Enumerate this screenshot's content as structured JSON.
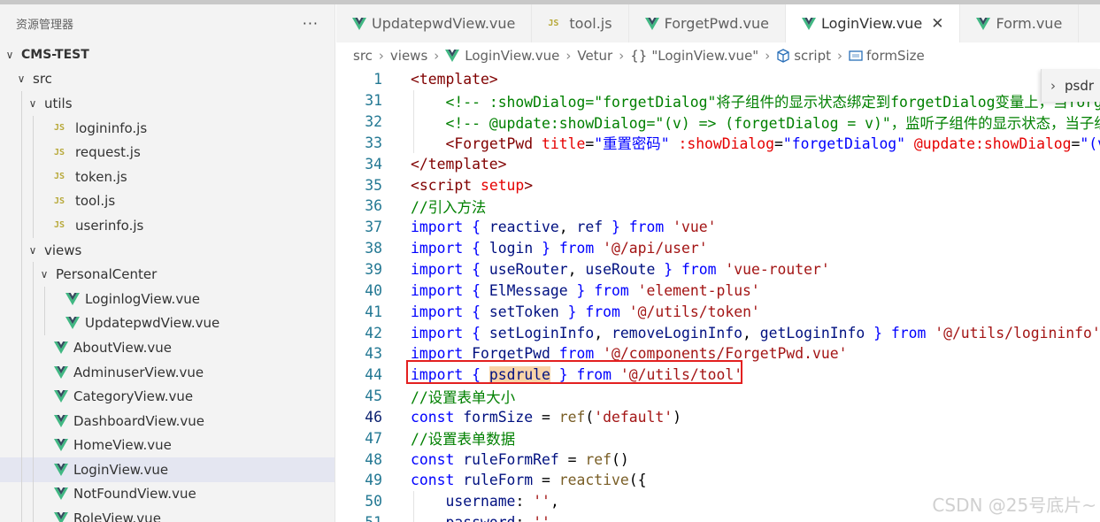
{
  "explorer": {
    "title": "资源管理器",
    "more": "···",
    "root": "CMS-TEST",
    "items": [
      {
        "label": "src",
        "type": "folder",
        "depth": 1,
        "open": true
      },
      {
        "label": "utils",
        "type": "folder",
        "depth": 2,
        "open": true
      },
      {
        "label": "logininfo.js",
        "type": "js",
        "depth": 3
      },
      {
        "label": "request.js",
        "type": "js",
        "depth": 3
      },
      {
        "label": "token.js",
        "type": "js",
        "depth": 3
      },
      {
        "label": "tool.js",
        "type": "js",
        "depth": 3
      },
      {
        "label": "userinfo.js",
        "type": "js",
        "depth": 3
      },
      {
        "label": "views",
        "type": "folder",
        "depth": 2,
        "open": true
      },
      {
        "label": "PersonalCenter",
        "type": "folder",
        "depth": 3,
        "open": true
      },
      {
        "label": "LoginlogView.vue",
        "type": "vue",
        "depth": 4
      },
      {
        "label": "UpdatepwdView.vue",
        "type": "vue",
        "depth": 4
      },
      {
        "label": "AboutView.vue",
        "type": "vue",
        "depth": 3
      },
      {
        "label": "AdminuserView.vue",
        "type": "vue",
        "depth": 3
      },
      {
        "label": "CategoryView.vue",
        "type": "vue",
        "depth": 3
      },
      {
        "label": "DashboardView.vue",
        "type": "vue",
        "depth": 3
      },
      {
        "label": "HomeView.vue",
        "type": "vue",
        "depth": 3
      },
      {
        "label": "LoginView.vue",
        "type": "vue",
        "depth": 3,
        "selected": true
      },
      {
        "label": "NotFoundView.vue",
        "type": "vue",
        "depth": 3
      },
      {
        "label": "RoleView.vue",
        "type": "vue",
        "depth": 3
      }
    ]
  },
  "tabs": [
    {
      "label": "UpdatepwdView.vue",
      "type": "vue"
    },
    {
      "label": "tool.js",
      "type": "js"
    },
    {
      "label": "ForgetPwd.vue",
      "type": "vue"
    },
    {
      "label": "LoginView.vue",
      "type": "vue",
      "active": true,
      "close": "✕"
    },
    {
      "label": "Form.vue",
      "type": "vue"
    }
  ],
  "breadcrumb": {
    "parts": [
      "src",
      "views",
      "LoginView.vue",
      "Vetur",
      "\"LoginView.vue\"",
      "script",
      "formSize"
    ],
    "sep": "›"
  },
  "sticky_suggest": {
    "arrow": "›",
    "label": "psdr"
  },
  "code": [
    {
      "n": "1",
      "tokens": [
        [
          "t-tag",
          "<template>"
        ]
      ]
    },
    {
      "n": "31",
      "tokens": [
        [
          "t-plain",
          "    "
        ],
        [
          "t-cm",
          "<!-- :showDialog=\"forgetDialog\"将子组件的显示状态绑定到forgetDialog变量上，当forgetDialog为true时显示子组件 -->"
        ]
      ]
    },
    {
      "n": "32",
      "tokens": [
        [
          "t-plain",
          "    "
        ],
        [
          "t-cm",
          "<!-- @update:showDialog=\"(v) => (forgetDialog = v)\"，监听子组件的显示状态，当子组件关闭时更新forgetDialog -->"
        ]
      ]
    },
    {
      "n": "33",
      "tokens": [
        [
          "t-plain",
          "    "
        ],
        [
          "t-tag",
          "<ForgetPwd"
        ],
        [
          "t-plain",
          " "
        ],
        [
          "t-attr",
          "title"
        ],
        [
          "t-plain",
          "="
        ],
        [
          "t-str",
          "\"重置密码\""
        ],
        [
          "t-plain",
          " "
        ],
        [
          "t-attr",
          ":showDialog"
        ],
        [
          "t-plain",
          "="
        ],
        [
          "t-str",
          "\"forgetDialog\""
        ],
        [
          "t-plain",
          " "
        ],
        [
          "t-attr",
          "@update:showDialog"
        ],
        [
          "t-plain",
          "="
        ],
        [
          "t-str",
          "\"(v) => (forgetDialog = v)\""
        ],
        [
          "t-tag",
          "/>"
        ]
      ]
    },
    {
      "n": "34",
      "tokens": [
        [
          "t-tag",
          "</template>"
        ]
      ]
    },
    {
      "n": "35",
      "tokens": [
        [
          "t-tag",
          "<script"
        ],
        [
          "t-plain",
          " "
        ],
        [
          "t-attr",
          "setup"
        ],
        [
          "t-tag",
          ">"
        ]
      ]
    },
    {
      "n": "36",
      "tokens": [
        [
          "t-cm",
          "//引入方法"
        ]
      ]
    },
    {
      "n": "37",
      "tokens": [
        [
          "t-kw",
          "import"
        ],
        [
          "t-plain",
          " "
        ],
        [
          "t-kw",
          "{"
        ],
        [
          "t-plain",
          " "
        ],
        [
          "t-var",
          "reactive"
        ],
        [
          "t-plain",
          ", "
        ],
        [
          "t-var",
          "ref"
        ],
        [
          "t-plain",
          " "
        ],
        [
          "t-kw",
          "}"
        ],
        [
          "t-plain",
          " "
        ],
        [
          "t-kw",
          "from"
        ],
        [
          "t-plain",
          " "
        ],
        [
          "t-str2",
          "'vue'"
        ]
      ]
    },
    {
      "n": "38",
      "tokens": [
        [
          "t-kw",
          "import"
        ],
        [
          "t-plain",
          " "
        ],
        [
          "t-kw",
          "{"
        ],
        [
          "t-plain",
          " "
        ],
        [
          "t-var",
          "login"
        ],
        [
          "t-plain",
          " "
        ],
        [
          "t-kw",
          "}"
        ],
        [
          "t-plain",
          " "
        ],
        [
          "t-kw",
          "from"
        ],
        [
          "t-plain",
          " "
        ],
        [
          "t-str2",
          "'@/api/user'"
        ]
      ]
    },
    {
      "n": "39",
      "tokens": [
        [
          "t-kw",
          "import"
        ],
        [
          "t-plain",
          " "
        ],
        [
          "t-kw",
          "{"
        ],
        [
          "t-plain",
          " "
        ],
        [
          "t-var",
          "useRouter"
        ],
        [
          "t-plain",
          ", "
        ],
        [
          "t-var",
          "useRoute"
        ],
        [
          "t-plain",
          " "
        ],
        [
          "t-kw",
          "}"
        ],
        [
          "t-plain",
          " "
        ],
        [
          "t-kw",
          "from"
        ],
        [
          "t-plain",
          " "
        ],
        [
          "t-str2",
          "'vue-router'"
        ]
      ]
    },
    {
      "n": "40",
      "tokens": [
        [
          "t-kw",
          "import"
        ],
        [
          "t-plain",
          " "
        ],
        [
          "t-kw",
          "{"
        ],
        [
          "t-plain",
          " "
        ],
        [
          "t-var",
          "ElMessage"
        ],
        [
          "t-plain",
          " "
        ],
        [
          "t-kw",
          "}"
        ],
        [
          "t-plain",
          " "
        ],
        [
          "t-kw",
          "from"
        ],
        [
          "t-plain",
          " "
        ],
        [
          "t-str2",
          "'element-plus'"
        ]
      ]
    },
    {
      "n": "41",
      "tokens": [
        [
          "t-kw",
          "import"
        ],
        [
          "t-plain",
          " "
        ],
        [
          "t-kw",
          "{"
        ],
        [
          "t-plain",
          " "
        ],
        [
          "t-var",
          "setToken"
        ],
        [
          "t-plain",
          " "
        ],
        [
          "t-kw",
          "}"
        ],
        [
          "t-plain",
          " "
        ],
        [
          "t-kw",
          "from"
        ],
        [
          "t-plain",
          " "
        ],
        [
          "t-str2",
          "'@/utils/token'"
        ]
      ]
    },
    {
      "n": "42",
      "tokens": [
        [
          "t-kw",
          "import"
        ],
        [
          "t-plain",
          " "
        ],
        [
          "t-kw",
          "{"
        ],
        [
          "t-plain",
          " "
        ],
        [
          "t-var",
          "setLoginInfo"
        ],
        [
          "t-plain",
          ", "
        ],
        [
          "t-var",
          "removeLoginInfo"
        ],
        [
          "t-plain",
          ", "
        ],
        [
          "t-var",
          "getLoginInfo"
        ],
        [
          "t-plain",
          " "
        ],
        [
          "t-kw",
          "}"
        ],
        [
          "t-plain",
          " "
        ],
        [
          "t-kw",
          "from"
        ],
        [
          "t-plain",
          " "
        ],
        [
          "t-str2",
          "'@/utils/logininfo'"
        ]
      ]
    },
    {
      "n": "43",
      "tokens": [
        [
          "t-kw",
          "import"
        ],
        [
          "t-plain",
          " "
        ],
        [
          "t-var",
          "ForgetPwd"
        ],
        [
          "t-plain",
          " "
        ],
        [
          "t-kw",
          "from"
        ],
        [
          "t-plain",
          " "
        ],
        [
          "t-str2",
          "'@/components/ForgetPwd.vue'"
        ]
      ]
    },
    {
      "n": "44",
      "tokens": [
        [
          "t-kw",
          "import"
        ],
        [
          "t-plain",
          " "
        ],
        [
          "t-kw",
          "{"
        ],
        [
          "t-plain",
          " "
        ],
        [
          "t-var t-hl",
          "psdrule"
        ],
        [
          "t-plain",
          " "
        ],
        [
          "t-kw",
          "}"
        ],
        [
          "t-plain",
          " "
        ],
        [
          "t-kw",
          "from"
        ],
        [
          "t-plain",
          " "
        ],
        [
          "t-str2",
          "'@/utils/tool'"
        ]
      ]
    },
    {
      "n": "45",
      "tokens": [
        [
          "t-cm",
          "//设置表单大小"
        ]
      ]
    },
    {
      "n": "46",
      "cur": true,
      "tokens": [
        [
          "t-kw",
          "const"
        ],
        [
          "t-plain",
          " "
        ],
        [
          "t-var",
          "formSize"
        ],
        [
          "t-plain",
          " = "
        ],
        [
          "t-fn",
          "ref"
        ],
        [
          "t-plain",
          "("
        ],
        [
          "t-str2",
          "'default'"
        ],
        [
          "t-plain",
          ")"
        ]
      ]
    },
    {
      "n": "47",
      "tokens": [
        [
          "t-cm",
          "//设置表单数据"
        ]
      ]
    },
    {
      "n": "48",
      "tokens": [
        [
          "t-kw",
          "const"
        ],
        [
          "t-plain",
          " "
        ],
        [
          "t-var",
          "ruleFormRef"
        ],
        [
          "t-plain",
          " = "
        ],
        [
          "t-fn",
          "ref"
        ],
        [
          "t-plain",
          "()"
        ]
      ]
    },
    {
      "n": "49",
      "tokens": [
        [
          "t-kw",
          "const"
        ],
        [
          "t-plain",
          " "
        ],
        [
          "t-var",
          "ruleForm"
        ],
        [
          "t-plain",
          " = "
        ],
        [
          "t-fn",
          "reactive"
        ],
        [
          "t-plain",
          "({"
        ]
      ]
    },
    {
      "n": "50",
      "tokens": [
        [
          "t-plain",
          "    "
        ],
        [
          "t-var",
          "username"
        ],
        [
          "t-plain",
          ": "
        ],
        [
          "t-str2",
          "''"
        ],
        [
          "t-plain",
          ","
        ]
      ]
    },
    {
      "n": "51",
      "tokens": [
        [
          "t-plain",
          "    "
        ],
        [
          "t-var",
          "password"
        ],
        [
          "t-plain",
          ": "
        ],
        [
          "t-str2",
          "''"
        ]
      ]
    }
  ],
  "watermark": "CSDN @25号底片~",
  "colors": {
    "highlight_border": "#e32020",
    "js_icon": "#b8a93a",
    "vue_icon_outer": "#41b883",
    "vue_icon_inner": "#35495e"
  }
}
